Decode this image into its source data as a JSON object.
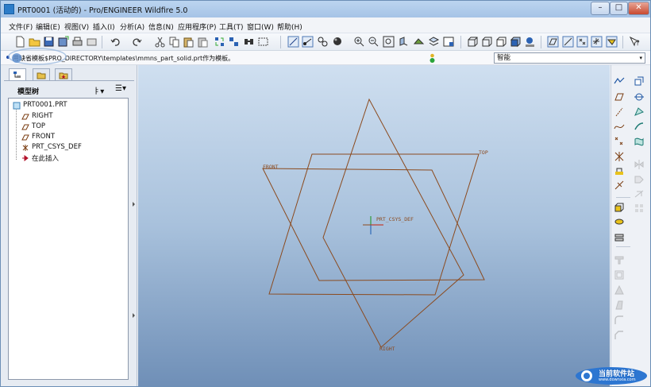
{
  "window": {
    "title": "PRT0001 (活动的) - Pro/ENGINEER Wildfire 5.0",
    "minimize": "–",
    "maximize": "□",
    "close": "✕"
  },
  "menubar": {
    "items": [
      "文件(F)",
      "编辑(E)",
      "视图(V)",
      "插入(I)",
      "分析(A)",
      "信息(N)",
      "应用程序(P)",
      "工具(T)",
      "窗口(W)",
      "帮助(H)"
    ]
  },
  "message_line": {
    "text": "用缺省模板$PRO_DIRECTORY\\templates\\mmns_part_solid.prt作为模板。",
    "filter_value": "智能",
    "filter_arrow": "▾"
  },
  "model_tree": {
    "title": "模型树",
    "settings_icon": "ㅑ▾",
    "show_icon": "☰▾",
    "items": [
      {
        "label": "PRT0001.PRT",
        "icon": "part-icon"
      },
      {
        "label": "RIGHT",
        "icon": "datum-plane-icon"
      },
      {
        "label": "TOP",
        "icon": "datum-plane-icon"
      },
      {
        "label": "FRONT",
        "icon": "datum-plane-icon"
      },
      {
        "label": "PRT_CSYS_DEF",
        "icon": "csys-icon"
      },
      {
        "label": "在此插入",
        "icon": "insert-arrow-icon"
      }
    ]
  },
  "graphics": {
    "labels": {
      "front": "FRONT",
      "top": "TOP",
      "right": "RIGHT",
      "csys": "PRT_CSYS_DEF"
    },
    "colors": {
      "datum": "#8b4a1e",
      "bg_top": "#cfdff0",
      "bg_bottom": "#6f8fb7"
    }
  },
  "watermark": {
    "bottom_text": "当前软件站",
    "bottom_sub": "www.downxia.com"
  }
}
